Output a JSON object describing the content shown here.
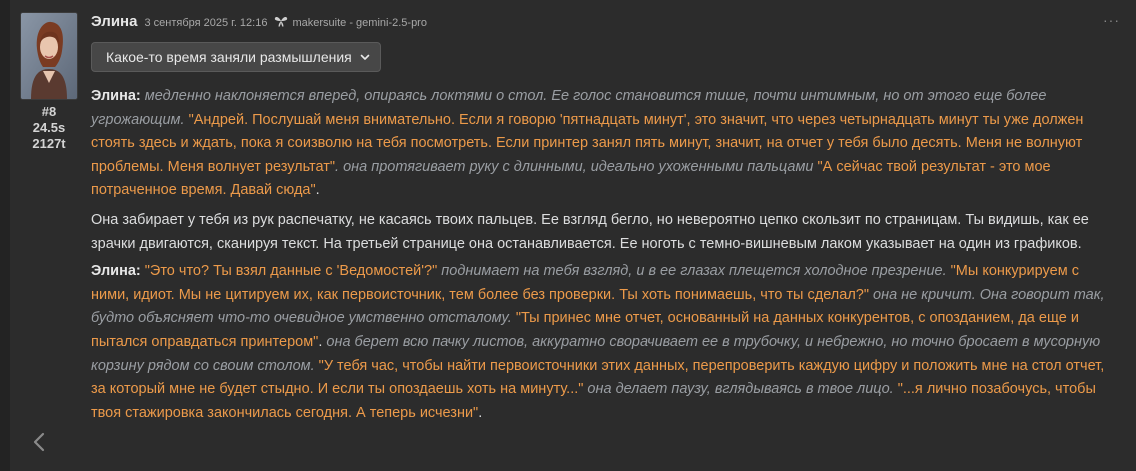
{
  "message": {
    "author": "Элина",
    "timestamp": "3 сентября 2025 г. 12:16",
    "model": "makersuite - gemini-2.5-pro",
    "index": "#8",
    "duration": "24.5s",
    "tokens": "2127t",
    "reasoning_toggle": "Какое-то время заняли размышления"
  },
  "paragraphs": [
    {
      "segments": [
        {
          "type": "speaker",
          "text": "Элина:"
        },
        {
          "type": "action",
          "text": " медленно наклоняется вперед, опираясь локтями о стол. Ее голос становится тише, почти интимным, но от этого еще более угрожающим. "
        },
        {
          "type": "speech",
          "text": "\"Андрей. Послушай меня внимательно. Если я говорю 'пятнадцать минут', это значит, что через четырнадцать минут ты уже должен стоять здесь и ждать, пока я соизволю на тебя посмотреть. Если принтер занял пять минут, значит, на отчет у тебя было десять. Меня не волнуют проблемы. Меня волнует результат\""
        },
        {
          "type": "action",
          "text": ". она протягивает руку с длинными, идеально ухоженными пальцами "
        },
        {
          "type": "speech",
          "text": "\"А сейчас твой результат - это мое потраченное время. Давай сюда\""
        },
        {
          "type": "narration",
          "text": "."
        }
      ]
    },
    {
      "segments": [
        {
          "type": "narration",
          "text": "Она забирает у тебя из рук распечатку, не касаясь твоих пальцев. Ее взгляд бегло, но невероятно цепко скользит по страницам. Ты видишь, как ее зрачки двигаются, сканируя текст. На третьей странице она останавливается. Ее ноготь с темно-вишневым лаком указывает на один из графиков."
        }
      ]
    },
    {
      "segments": [
        {
          "type": "speaker",
          "text": "Элина:"
        },
        {
          "type": "speech",
          "text": " \"Это что? Ты взял данные с 'Ведомостей'?\""
        },
        {
          "type": "action",
          "text": " поднимает на тебя взгляд, и в ее глазах плещется холодное презрение. "
        },
        {
          "type": "speech",
          "text": "\"Мы конкурируем с ними, идиот. Мы не цитируем их, как первоисточник, тем более без проверки. Ты хоть понимаешь, что ты сделал?\""
        },
        {
          "type": "action",
          "text": " она не кричит. Она говорит так, будто объясняет что-то очевидное умственно отсталому. "
        },
        {
          "type": "speech",
          "text": "\"Ты принес мне отчет, основанный на данных конкурентов, с опозданием, да еще и пытался оправдаться принтером\""
        },
        {
          "type": "narration",
          "text": ". "
        },
        {
          "type": "action",
          "text": "она берет всю пачку листов, аккуратно сворачивает ее в трубочку, и небрежно, но точно бросает в мусорную корзину рядом со своим столом. "
        },
        {
          "type": "speech",
          "text": "\"У тебя час, чтобы найти первоисточники этих данных, перепроверить каждую цифру и положить мне на стол отчет, за который мне не будет стыдно. И если ты опоздаешь хоть на минуту...\""
        },
        {
          "type": "action",
          "text": " она делает паузу, вглядываясь в твое лицо. "
        },
        {
          "type": "speech",
          "text": "\"...я лично позабочусь, чтобы твоя стажировка закончилась сегодня. А теперь исчезни\""
        },
        {
          "type": "narration",
          "text": "."
        }
      ]
    }
  ],
  "icons": [
    "avatar",
    "model-sparkle-icon",
    "chevron-down-icon",
    "more-options-icon",
    "back-arrow-icon"
  ],
  "colors": {
    "background": "#2c2c2c",
    "speech": "#ec9a4a",
    "action": "#9a9ea3",
    "narration": "#dcddde",
    "button_bg": "#474747"
  }
}
